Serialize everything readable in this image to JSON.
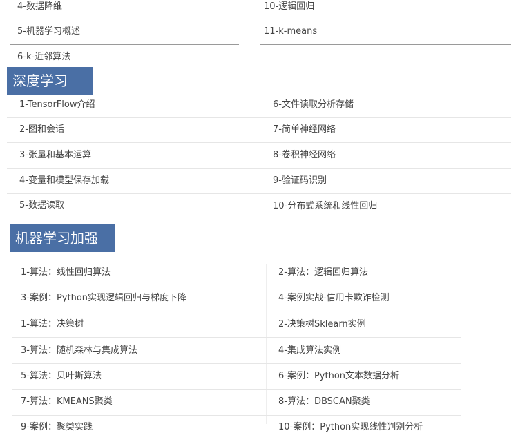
{
  "top": {
    "left": [
      "4-数据降维",
      "5-机器学习概述",
      "6-k-近邻算法"
    ],
    "right": [
      "10-逻辑回归",
      "11-k-means"
    ]
  },
  "deep": {
    "title": "深度学习",
    "left": [
      "1-TensorFlow介绍",
      "2-图和会话",
      "3-张量和基本运算",
      "4-变量和模型保存加载",
      "5-数据读取"
    ],
    "right": [
      "6-文件读取分析存储",
      "7-简单神经网络",
      "8-卷积神经网络",
      "9-验证码识别",
      "10-分布式系统和线性回归"
    ]
  },
  "ml": {
    "title": "机器学习加强",
    "left": [
      "1-算法：线性回归算法",
      "3-案例：Python实现逻辑回归与梯度下降",
      "1-算法：决策树",
      "3-算法：随机森林与集成算法",
      "5-算法：贝叶斯算法",
      "7-算法：KMEANS聚类",
      "9-案例：聚类实践"
    ],
    "right": [
      "2-算法：逻辑回归算法",
      "4-案例实战-信用卡欺诈检测",
      "2-决策树Sklearn实例",
      "4-集成算法实例",
      "6-案例：Python文本数据分析",
      "8-算法：DBSCAN聚类",
      "10-案例：Python实现线性判别分析"
    ]
  },
  "colors": {
    "header": "#4a6fa5"
  }
}
